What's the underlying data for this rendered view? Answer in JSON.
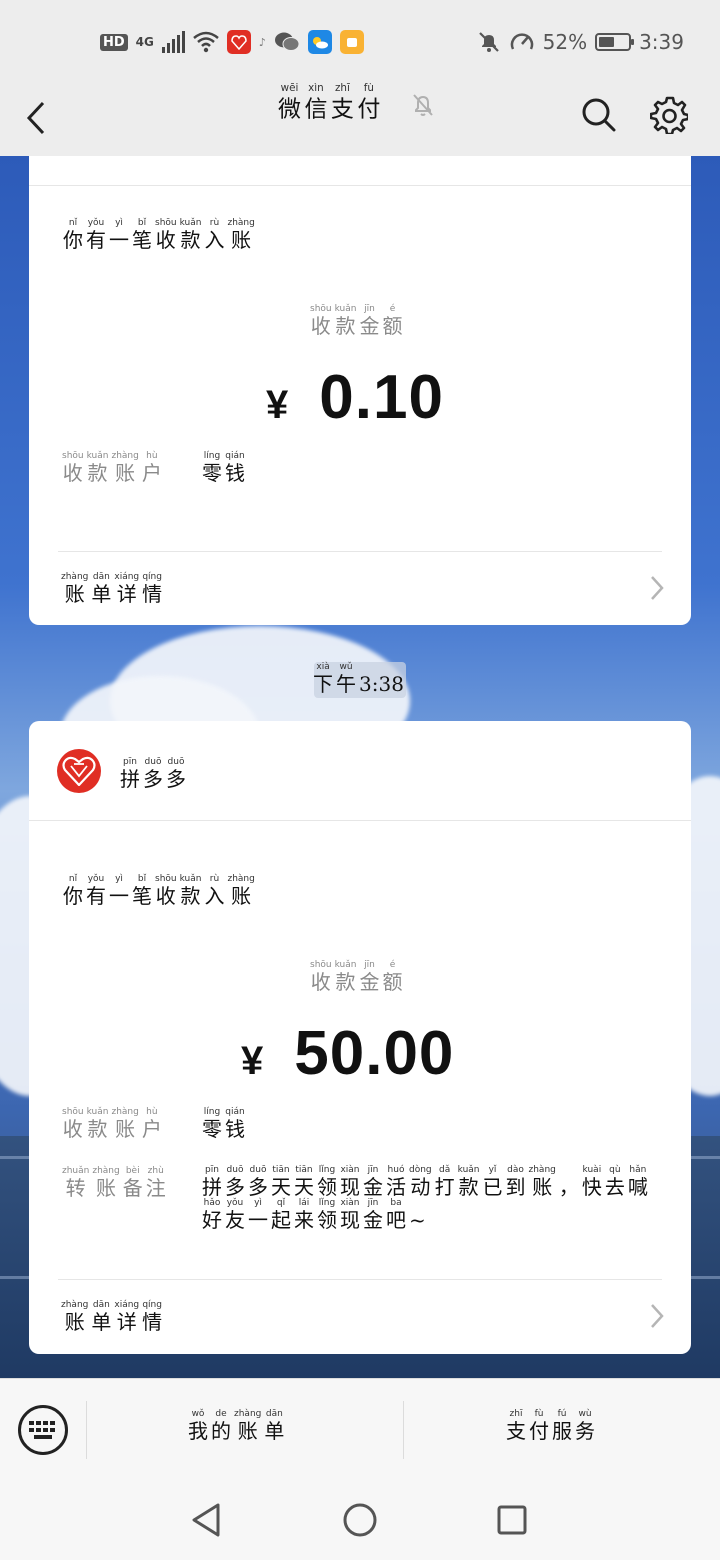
{
  "status_bar": {
    "hd": "HD",
    "network": "4G",
    "battery_text": "52%",
    "battery_level": 0.52,
    "time": "3:39",
    "icons": [
      "signal-icon",
      "wifi-icon",
      "pinduoduo-app-icon",
      "wechat-icon",
      "weather-icon",
      "notes-app-icon",
      "mute-icon",
      "speed-icon",
      "battery-icon"
    ]
  },
  "header": {
    "title": [
      {
        "hz": "微",
        "py": "wēi"
      },
      {
        "hz": "信",
        "py": "xìn"
      },
      {
        "hz": "支",
        "py": "zhī"
      },
      {
        "hz": "付",
        "py": "fù"
      }
    ]
  },
  "card1": {
    "intro": [
      {
        "hz": "你",
        "py": "nǐ"
      },
      {
        "hz": "有",
        "py": "yǒu"
      },
      {
        "hz": "一",
        "py": "yì"
      },
      {
        "hz": "笔",
        "py": "bǐ"
      },
      {
        "hz": "收",
        "py": "shōu"
      },
      {
        "hz": "款",
        "py": "kuǎn"
      },
      {
        "hz": "入",
        "py": "rù"
      },
      {
        "hz": "账",
        "py": "zhàng"
      }
    ],
    "amount_label": [
      {
        "hz": "收",
        "py": "shōu"
      },
      {
        "hz": "款",
        "py": "kuǎn"
      },
      {
        "hz": "金",
        "py": "jīn"
      },
      {
        "hz": "额",
        "py": "é"
      }
    ],
    "currency": "¥",
    "amount": "0.10",
    "account_label": [
      {
        "hz": "收",
        "py": "shōu"
      },
      {
        "hz": "款",
        "py": "kuǎn"
      },
      {
        "hz": "账",
        "py": "zhàng"
      },
      {
        "hz": "户",
        "py": "hù"
      }
    ],
    "account_value": [
      {
        "hz": "零",
        "py": "líng"
      },
      {
        "hz": "钱",
        "py": "qián"
      }
    ],
    "details": [
      {
        "hz": "账",
        "py": "zhàng"
      },
      {
        "hz": "单",
        "py": "dān"
      },
      {
        "hz": "详",
        "py": "xiáng"
      },
      {
        "hz": "情",
        "py": "qíng"
      }
    ]
  },
  "timestamp": [
    {
      "hz": "下",
      "py": "xià"
    },
    {
      "hz": "午",
      "py": "wǔ"
    },
    {
      "hz": "3:38",
      "py": ""
    }
  ],
  "card2": {
    "merchant": [
      {
        "hz": "拼",
        "py": "pīn"
      },
      {
        "hz": "多",
        "py": "duō"
      },
      {
        "hz": "多",
        "py": "duō"
      }
    ],
    "intro": [
      {
        "hz": "你",
        "py": "nǐ"
      },
      {
        "hz": "有",
        "py": "yǒu"
      },
      {
        "hz": "一",
        "py": "yì"
      },
      {
        "hz": "笔",
        "py": "bǐ"
      },
      {
        "hz": "收",
        "py": "shōu"
      },
      {
        "hz": "款",
        "py": "kuǎn"
      },
      {
        "hz": "入",
        "py": "rù"
      },
      {
        "hz": "账",
        "py": "zhàng"
      }
    ],
    "amount_label": [
      {
        "hz": "收",
        "py": "shōu"
      },
      {
        "hz": "款",
        "py": "kuǎn"
      },
      {
        "hz": "金",
        "py": "jīn"
      },
      {
        "hz": "额",
        "py": "é"
      }
    ],
    "currency": "¥",
    "amount": "50.00",
    "account_label": [
      {
        "hz": "收",
        "py": "shōu"
      },
      {
        "hz": "款",
        "py": "kuǎn"
      },
      {
        "hz": "账",
        "py": "zhàng"
      },
      {
        "hz": "户",
        "py": "hù"
      }
    ],
    "account_value": [
      {
        "hz": "零",
        "py": "líng"
      },
      {
        "hz": "钱",
        "py": "qián"
      }
    ],
    "remark_label": [
      {
        "hz": "转",
        "py": "zhuǎn"
      },
      {
        "hz": "账",
        "py": "zhàng"
      },
      {
        "hz": "备",
        "py": "bèi"
      },
      {
        "hz": "注",
        "py": "zhù"
      }
    ],
    "remark_value": [
      {
        "hz": "拼",
        "py": "pīn"
      },
      {
        "hz": "多",
        "py": "duō"
      },
      {
        "hz": "多",
        "py": "duō"
      },
      {
        "hz": "天",
        "py": "tiān"
      },
      {
        "hz": "天",
        "py": "tiān"
      },
      {
        "hz": "领",
        "py": "lǐng"
      },
      {
        "hz": "现",
        "py": "xiàn"
      },
      {
        "hz": "金",
        "py": "jīn"
      },
      {
        "hz": "活",
        "py": "huó"
      },
      {
        "hz": "动",
        "py": "dòng"
      },
      {
        "hz": "打",
        "py": "dǎ"
      },
      {
        "hz": "款",
        "py": "kuǎn"
      },
      {
        "hz": "已",
        "py": "yǐ"
      },
      {
        "hz": "到",
        "py": "dào"
      },
      {
        "hz": "账",
        "py": "zhàng"
      },
      {
        "hz": "，",
        "py": ""
      },
      {
        "hz": "快",
        "py": "kuài"
      },
      {
        "hz": "去",
        "py": "qù"
      },
      {
        "hz": "喊",
        "py": "hǎn"
      },
      {
        "hz": "好",
        "py": "hǎo"
      },
      {
        "hz": "友",
        "py": "yǒu"
      },
      {
        "hz": "一",
        "py": "yì"
      },
      {
        "hz": "起",
        "py": "qǐ"
      },
      {
        "hz": "来",
        "py": "lái"
      },
      {
        "hz": "领",
        "py": "lǐng"
      },
      {
        "hz": "现",
        "py": "xiàn"
      },
      {
        "hz": "金",
        "py": "jīn"
      },
      {
        "hz": "吧",
        "py": "ba"
      },
      {
        "hz": "~",
        "py": ""
      }
    ],
    "details": [
      {
        "hz": "账",
        "py": "zhàng"
      },
      {
        "hz": "单",
        "py": "dān"
      },
      {
        "hz": "详",
        "py": "xiáng"
      },
      {
        "hz": "情",
        "py": "qíng"
      }
    ]
  },
  "bottom_menu": {
    "my_bills": [
      {
        "hz": "我",
        "py": "wǒ"
      },
      {
        "hz": "的",
        "py": "de"
      },
      {
        "hz": "账",
        "py": "zhàng"
      },
      {
        "hz": "单",
        "py": "dān"
      }
    ],
    "pay_services": [
      {
        "hz": "支",
        "py": "zhī"
      },
      {
        "hz": "付",
        "py": "fù"
      },
      {
        "hz": "服",
        "py": "fú"
      },
      {
        "hz": "务",
        "py": "wù"
      }
    ]
  },
  "colors": {
    "pdd_red": "#e02e24",
    "chat_bg_blue": "#3f73cf",
    "card_bg": "#ffffff",
    "muted_text": "#8a8a8a"
  }
}
